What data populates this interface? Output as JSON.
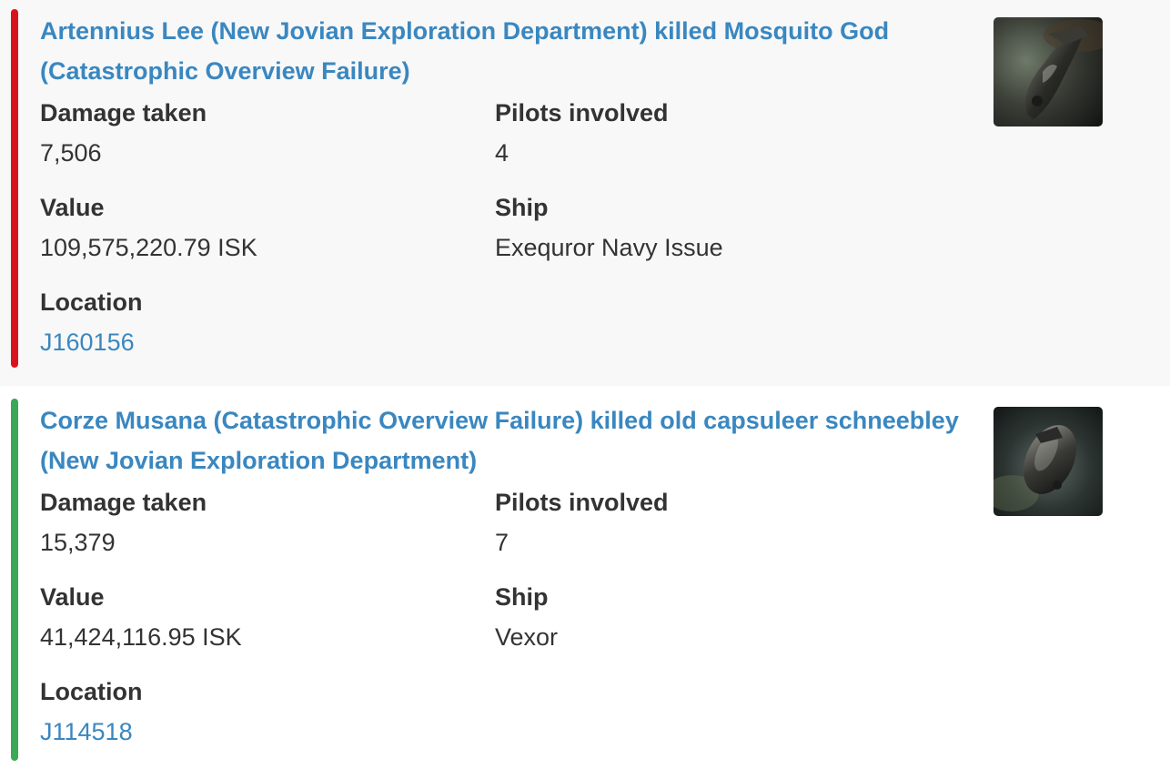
{
  "kills": [
    {
      "status": "loss",
      "stripe_color": "#d9131e",
      "title": "Artennius Lee (New Jovian Exploration Department) killed Mosquito God (Catastrophic Overview Failure)",
      "damage_label": "Damage taken",
      "damage_value": "7,506",
      "pilots_label": "Pilots involved",
      "pilots_value": "4",
      "value_label": "Value",
      "value_value": "109,575,220.79 ISK",
      "ship_label": "Ship",
      "ship_value": "Exequror Navy Issue",
      "location_label": "Location",
      "location_value": "J160156",
      "ship_image": "ship-render-icon"
    },
    {
      "status": "win",
      "stripe_color": "#3aa856",
      "title": "Corze Musana (Catastrophic Overview Failure) killed old capsuleer schneebley (New Jovian Exploration Department)",
      "damage_label": "Damage taken",
      "damage_value": "15,379",
      "pilots_label": "Pilots involved",
      "pilots_value": "7",
      "value_label": "Value",
      "value_value": "41,424,116.95 ISK",
      "ship_label": "Ship",
      "ship_value": "Vexor",
      "location_label": "Location",
      "location_value": "J114518",
      "ship_image": "ship-render-icon"
    }
  ],
  "colors": {
    "link": "#3a87c0",
    "text": "#333333",
    "loss_bg": "#f8f8f8"
  }
}
